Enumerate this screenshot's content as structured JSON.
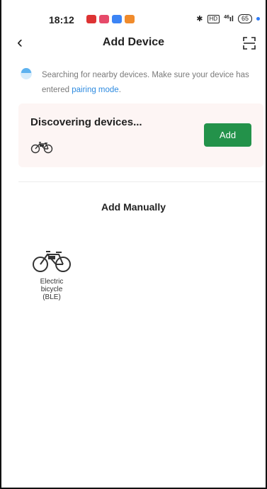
{
  "status_bar": {
    "time": "18:12",
    "network": "46",
    "battery": "65",
    "hd_label": "HD"
  },
  "header": {
    "title": "Add Device"
  },
  "hint": {
    "text": "Searching for nearby devices. Make sure your device has entered",
    "link": "pairing mode",
    "suffix": "."
  },
  "discover": {
    "title": "Discovering devices...",
    "add_label": "Add"
  },
  "manual": {
    "title": "Add Manually",
    "devices": [
      {
        "label": "Electric\nbicycle\n(BLE)"
      }
    ]
  },
  "colors": {
    "accent_green": "#23924a",
    "link_blue": "#2e8be0",
    "card_bg": "#fdf5f4"
  }
}
